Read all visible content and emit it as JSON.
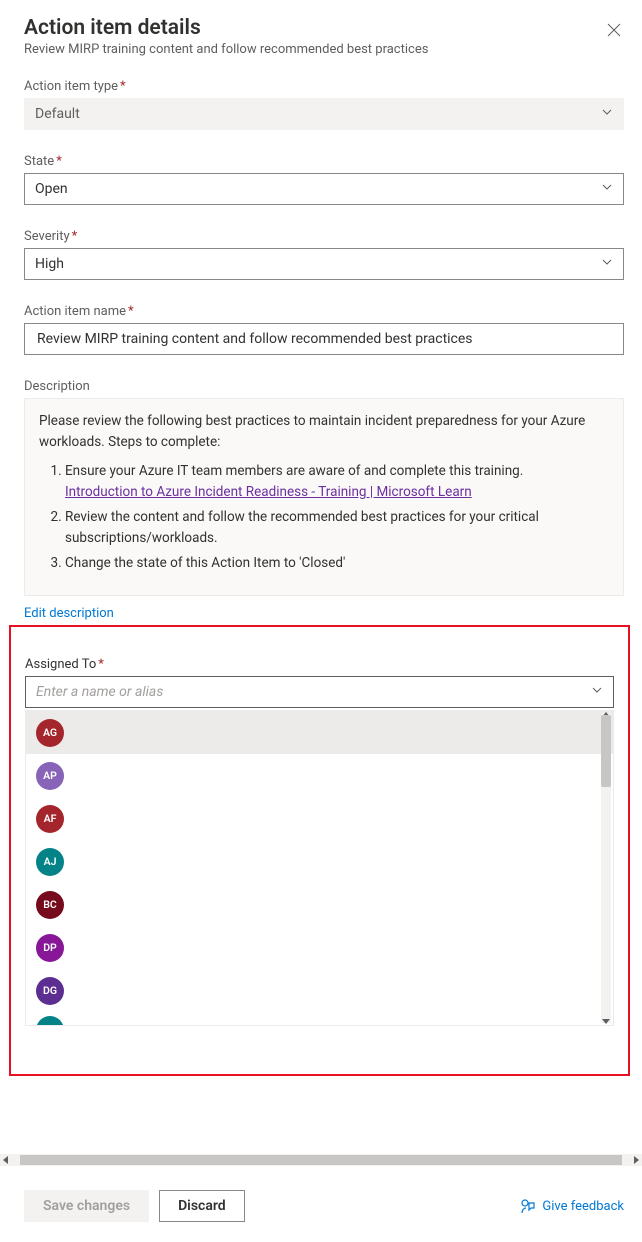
{
  "header": {
    "title": "Action item details",
    "subtitle": "Review MIRP training content and follow recommended best practices"
  },
  "fields": {
    "type_label": "Action item type",
    "type_value": "Default",
    "state_label": "State",
    "state_value": "Open",
    "severity_label": "Severity",
    "severity_value": "High",
    "name_label": "Action item name",
    "name_value": "Review MIRP training content and follow recommended best practices",
    "desc_label": "Description",
    "desc_intro": "Please review the following best practices to maintain incident preparedness for your Azure workloads. Steps to complete:",
    "desc_step1": "Ensure your Azure IT team members are aware of and complete this training.",
    "desc_link": "Introduction to Azure Incident Readiness - Training | Microsoft Learn",
    "desc_step2": "Review the content and follow the recommended best practices for your critical subscriptions/workloads.",
    "desc_step3": "Change the state of this Action Item to 'Closed'",
    "edit_link": "Edit description",
    "assigned_label": "Assigned To",
    "assigned_placeholder": "Enter a name or alias"
  },
  "people": [
    {
      "initials": "AG",
      "color": "#a4262c",
      "selected": true
    },
    {
      "initials": "AP",
      "color": "#8764b8",
      "selected": false
    },
    {
      "initials": "AF",
      "color": "#a4262c",
      "selected": false
    },
    {
      "initials": "AJ",
      "color": "#038387",
      "selected": false
    },
    {
      "initials": "BC",
      "color": "#750b1c",
      "selected": false
    },
    {
      "initials": "DP",
      "color": "#881798",
      "selected": false
    },
    {
      "initials": "DG",
      "color": "#5c2e91",
      "selected": false
    }
  ],
  "people_partial_color": "#038387",
  "footer": {
    "save": "Save changes",
    "discard": "Discard",
    "feedback": "Give feedback"
  },
  "required_marker": "*"
}
